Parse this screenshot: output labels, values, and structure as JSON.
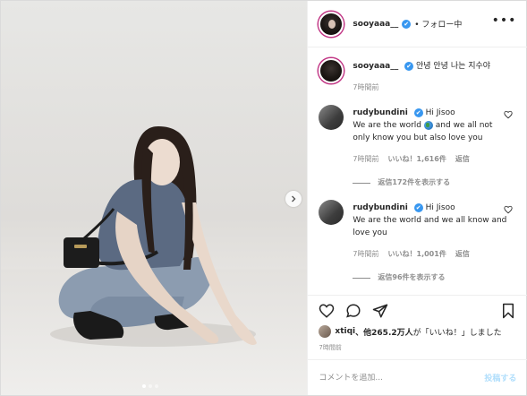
{
  "header": {
    "username": "sooyaaa__",
    "verified_glyph": "✔",
    "follow_status": "• フォロー中",
    "more_glyph": "•••"
  },
  "caption": {
    "username": "sooyaaa__",
    "text": "안녕 안녕 나는 지수야",
    "time": "7時間前"
  },
  "comments": [
    {
      "username": "rudybundini",
      "text_first": "Hi Jisoo",
      "text_rest_a": "We are the world",
      "text_rest_b": "and we all not only know you but also love you",
      "time": "7時間前",
      "likes": "いいね！1,616件",
      "reply": "返信",
      "view_replies": "返信172件を表示する"
    },
    {
      "username": "rudybundini",
      "text_first": "Hi Jisoo",
      "text_rest_a": "We are the world and we all know and love you",
      "time": "7時間前",
      "likes": "いいね！1,001件",
      "reply": "返信",
      "view_replies": "返信96件を表示する"
    }
  ],
  "likes": {
    "user": "xtiqi",
    "count_text": "、他265.2万人",
    "suffix": "が「いいね！」しました"
  },
  "post_time": "7時間前",
  "add_comment": {
    "placeholder": "コメントを追加...",
    "post_label": "投稿する"
  },
  "icons": {
    "next": "chevron-right-icon",
    "heart": "heart-icon",
    "comment": "comment-icon",
    "share": "share-icon",
    "bookmark": "bookmark-icon"
  }
}
